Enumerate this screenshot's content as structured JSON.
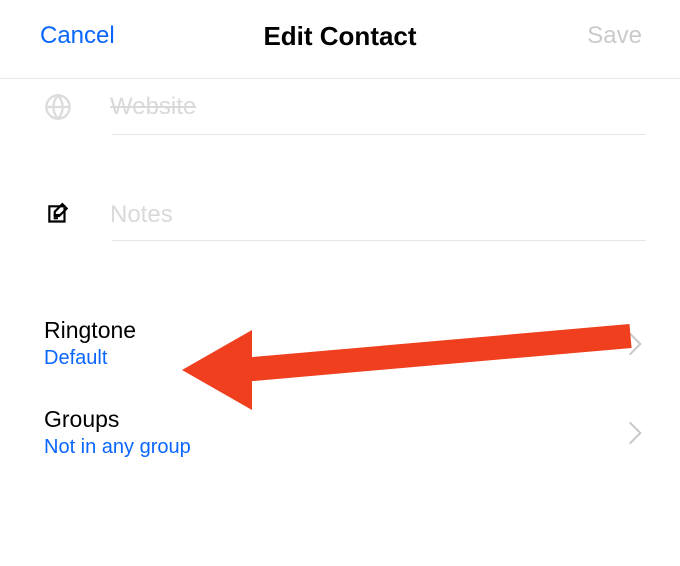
{
  "header": {
    "cancel_label": "Cancel",
    "title": "Edit Contact",
    "save_label": "Save"
  },
  "fields": {
    "website": {
      "placeholder": "Website",
      "value": ""
    },
    "notes": {
      "placeholder": "Notes",
      "value": ""
    }
  },
  "sections": {
    "ringtone": {
      "title": "Ringtone",
      "value": "Default"
    },
    "groups": {
      "title": "Groups",
      "value": "Not in any group"
    }
  },
  "colors": {
    "accent": "#0a66ff",
    "arrow": "#f03f1e"
  }
}
